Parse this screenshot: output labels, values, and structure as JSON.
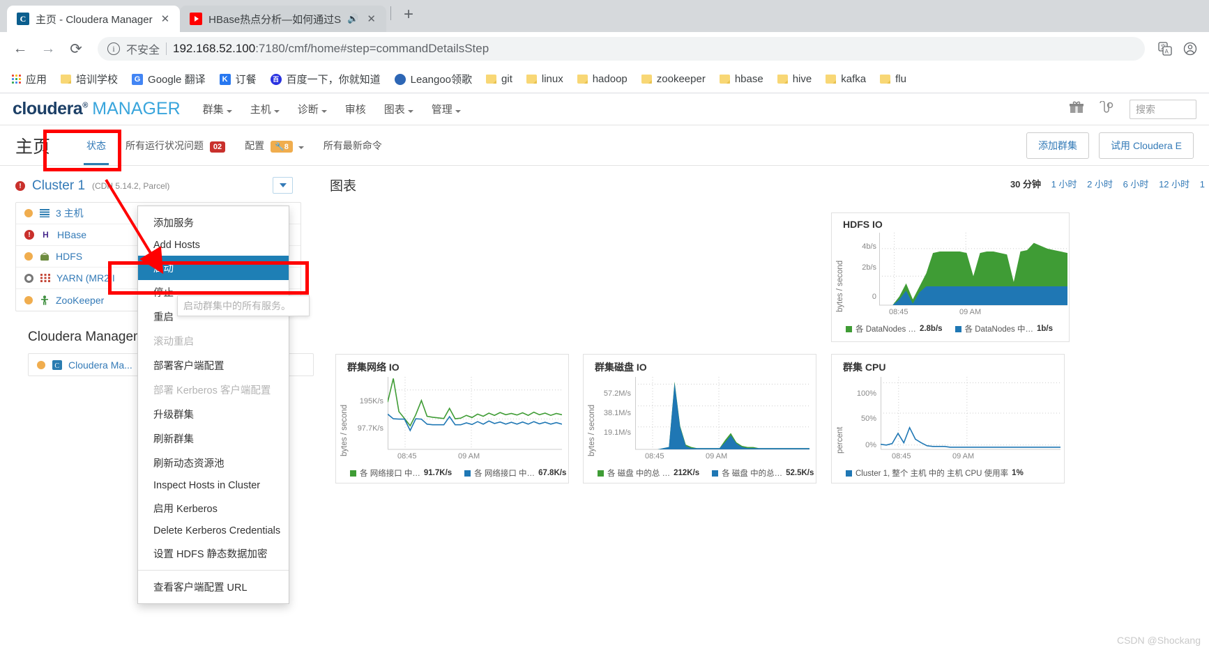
{
  "browser": {
    "tabs": [
      {
        "title": "主页 - Cloudera Manager",
        "favicon": "cloudera-icon",
        "active": true,
        "close": "✕"
      },
      {
        "title": "HBase热点分析—如何通过S",
        "favicon": "youtube-icon",
        "active": false,
        "speaker": "🔊",
        "close": "✕"
      }
    ],
    "new_tab_label": "+",
    "nav": {
      "back": "←",
      "forward": "→",
      "reload": "⟳"
    },
    "omnibox": {
      "info_icon": "ⓘ",
      "security_label": "不安全",
      "url_host": "192.168.52.100",
      "url_rest": ":7180/cmf/home#step=commandDetailsStep"
    },
    "toolbar_icons": [
      "translate-icon",
      "profile-icon"
    ],
    "bookmarks": [
      {
        "label": "应用",
        "icon": "apps-grid-icon"
      },
      {
        "label": "培训学校",
        "icon": "folder-icon"
      },
      {
        "label": "Google 翻译",
        "icon": "google-translate-icon"
      },
      {
        "label": "订餐",
        "icon": "k-icon"
      },
      {
        "label": "百度一下，你就知道",
        "icon": "baidu-icon"
      },
      {
        "label": "Leangoo领歌",
        "icon": "leangoo-icon"
      },
      {
        "label": "git",
        "icon": "folder-icon"
      },
      {
        "label": "linux",
        "icon": "folder-icon"
      },
      {
        "label": "hadoop",
        "icon": "folder-icon"
      },
      {
        "label": "zookeeper",
        "icon": "folder-icon"
      },
      {
        "label": "hbase",
        "icon": "folder-icon"
      },
      {
        "label": "hive",
        "icon": "folder-icon"
      },
      {
        "label": "kafka",
        "icon": "folder-icon"
      },
      {
        "label": "flu",
        "icon": "folder-icon"
      }
    ]
  },
  "cm_header": {
    "logo_primary": "cloudera",
    "logo_secondary": "MANAGER",
    "nav": [
      {
        "label": "群集",
        "has_caret": true
      },
      {
        "label": "主机",
        "has_caret": true
      },
      {
        "label": "诊断",
        "has_caret": true
      },
      {
        "label": "审核",
        "has_caret": false
      },
      {
        "label": "图表",
        "has_caret": true
      },
      {
        "label": "管理",
        "has_caret": true
      }
    ],
    "right_icons": [
      "gift-icon",
      "support-icon"
    ],
    "search_placeholder": "搜索"
  },
  "sub_header": {
    "page_title": "主页",
    "tabs": [
      {
        "label": "状态",
        "active": true
      },
      {
        "label": "所有运行状况问题",
        "active": false,
        "badge": "02",
        "badge_color": "#c9302c"
      },
      {
        "label": "配置",
        "active": false,
        "badge": "8",
        "badge_color": "#f0ad4e",
        "has_caret": true,
        "badge_icon": "wrench-icon"
      },
      {
        "label": "所有最新命令",
        "active": false
      }
    ],
    "buttons": [
      {
        "label": "添加群集"
      },
      {
        "label": "试用 Cloudera E"
      }
    ]
  },
  "sidebar": {
    "cluster": {
      "status_icon": "error-icon",
      "name": "Cluster 1",
      "version": "(CDH 5.14.2, Parcel)",
      "dropdown_icon": "chevron-down-icon"
    },
    "services": [
      {
        "status": "yellow",
        "icon": "hosts-icon",
        "label": "3 主机"
      },
      {
        "status": "error",
        "icon": "hbase-icon",
        "label": "HBase"
      },
      {
        "status": "yellow",
        "icon": "hdfs-icon",
        "label": "HDFS"
      },
      {
        "status": "ring",
        "icon": "yarn-icon",
        "label": "YARN (MR2 I"
      },
      {
        "status": "yellow",
        "icon": "zookeeper-icon",
        "label": "ZooKeeper"
      }
    ],
    "mgmt_section_title": "Cloudera Managem",
    "mgmt_services": [
      {
        "status": "yellow",
        "icon": "cm-icon",
        "label": "Cloudera Ma..."
      }
    ]
  },
  "menu": {
    "items": [
      {
        "label": "添加服务",
        "state": "normal"
      },
      {
        "label": "Add Hosts",
        "state": "normal"
      },
      {
        "label": "启动",
        "state": "selected"
      },
      {
        "label": "停止",
        "state": "normal"
      },
      {
        "label": "重启",
        "state": "normal"
      },
      {
        "label": "滚动重启",
        "state": "disabled"
      },
      {
        "label": "部署客户端配置",
        "state": "normal"
      },
      {
        "label": "部署 Kerberos 客户端配置",
        "state": "disabled"
      },
      {
        "label": "升级群集",
        "state": "normal"
      },
      {
        "label": "刷新群集",
        "state": "normal"
      },
      {
        "label": "刷新动态资源池",
        "state": "normal"
      },
      {
        "label": "Inspect Hosts in Cluster",
        "state": "normal"
      },
      {
        "label": "启用 Kerberos",
        "state": "normal"
      },
      {
        "label": "Delete Kerberos Credentials",
        "state": "normal"
      },
      {
        "label": "设置 HDFS 静态数据加密",
        "state": "normal"
      },
      {
        "label": "查看客户端配置 URL",
        "state": "normal",
        "separator_before": true
      }
    ],
    "tooltip": "启动群集中的所有服务。"
  },
  "charts_panel": {
    "title": "图表",
    "time_ranges": [
      {
        "label": "30 分钟",
        "selected": true
      },
      {
        "label": "1 小时",
        "selected": false
      },
      {
        "label": "2 小时",
        "selected": false
      },
      {
        "label": "6 小时",
        "selected": false
      },
      {
        "label": "12 小时",
        "selected": false
      },
      {
        "label": "1",
        "selected": false
      }
    ]
  },
  "chart_data": [
    {
      "type": "area",
      "id": "hdfs-io",
      "title": "HDFS IO",
      "ylabel": "bytes / second",
      "yticks": [
        "0",
        "2b/s",
        "4b/s"
      ],
      "ylim": [
        0,
        5
      ],
      "xticks": [
        "08:45",
        "09 AM"
      ],
      "series": [
        {
          "name": "各 DataNodes …",
          "value": "2.8b/s",
          "color": "#3f9c35",
          "values": [
            0,
            0,
            0,
            0.6,
            1.5,
            0.4,
            1.3,
            2.2,
            3.6,
            3.7,
            3.7,
            3.7,
            3.7,
            3.6,
            2.0,
            3.6,
            3.7,
            3.7,
            3.6,
            3.5,
            1.6,
            3.7,
            3.8,
            4.3,
            4.1,
            3.9,
            3.8,
            3.7,
            3.6
          ]
        },
        {
          "name": "各 DataNodes 中…",
          "value": "1b/s",
          "color": "#1f77b4",
          "values": [
            0,
            0,
            0,
            0.4,
            1.0,
            0.1,
            0.9,
            1.3,
            1.3,
            1.3,
            1.3,
            1.3,
            1.3,
            1.3,
            1.3,
            1.3,
            1.3,
            1.3,
            1.3,
            1.3,
            1.3,
            1.3,
            1.3,
            1.3,
            1.3,
            1.3,
            1.3,
            1.3,
            1.3
          ]
        }
      ]
    },
    {
      "type": "line",
      "id": "cluster-network-io",
      "title": "群集网络 IO",
      "ylabel": "bytes / second",
      "yticks": [
        "97.7K/s",
        "195K/s"
      ],
      "ylim": [
        0,
        230
      ],
      "xticks": [
        "08:45",
        "09 AM"
      ],
      "series": [
        {
          "name": "各 网络接口 中…",
          "value": "91.7K/s",
          "color": "#3f9c35",
          "values": [
            150,
            225,
            120,
            98,
            75,
            110,
            155,
            105,
            102,
            100,
            98,
            130,
            97,
            99,
            108,
            101,
            112,
            105,
            115,
            108,
            117,
            110,
            114,
            109,
            116,
            108,
            118,
            110,
            115,
            108,
            114,
            110
          ]
        },
        {
          "name": "各 网络接口 中…",
          "value": "67.8K/s",
          "color": "#1f77b4",
          "values": [
            112,
            97,
            96,
            96,
            60,
            97,
            96,
            80,
            78,
            78,
            78,
            104,
            78,
            78,
            84,
            79,
            88,
            80,
            90,
            82,
            87,
            80,
            86,
            80,
            87,
            80,
            88,
            81,
            86,
            80,
            85,
            80
          ]
        }
      ]
    },
    {
      "type": "area",
      "id": "cluster-disk-io",
      "title": "群集磁盘 IO",
      "ylabel": "bytes / second",
      "yticks": [
        "19.1M/s",
        "38.1M/s",
        "57.2M/s"
      ],
      "ylim": [
        0,
        62
      ],
      "xticks": [
        "08:45",
        "09 AM"
      ],
      "series": [
        {
          "name": "各 磁盘 中的总 …",
          "value": "212K/s",
          "color": "#3f9c35",
          "values": [
            0,
            0,
            0,
            0,
            0,
            1,
            2,
            58,
            20,
            4,
            2,
            1,
            1,
            1,
            1,
            1,
            8,
            14,
            6,
            3,
            2,
            2,
            1,
            1,
            1,
            1,
            1,
            1,
            1,
            1,
            1,
            1
          ]
        },
        {
          "name": "各 磁盘 中的总…",
          "value": "52.5K/s",
          "color": "#1f77b4",
          "values": [
            0,
            0,
            0,
            0,
            0,
            1,
            2,
            57,
            19,
            3,
            1,
            1,
            1,
            1,
            1,
            1,
            6,
            12,
            5,
            2,
            1,
            1,
            1,
            1,
            1,
            1,
            1,
            1,
            1,
            1,
            1,
            1
          ]
        }
      ]
    },
    {
      "type": "line",
      "id": "cluster-cpu",
      "title": "群集 CPU",
      "ylabel": "percent",
      "yticks": [
        "0%",
        "50%",
        "100%"
      ],
      "ylim": [
        0,
        100
      ],
      "xticks": [
        "08:45",
        "09 AM"
      ],
      "series": [
        {
          "name": "Cluster 1, 整个 主机 中的 主机 CPU 使用率",
          "value": "1%",
          "color": "#1f77b4",
          "values": [
            7,
            6,
            8,
            22,
            9,
            30,
            14,
            9,
            5,
            4,
            4,
            4,
            3,
            3,
            3,
            3,
            3,
            3,
            3,
            3,
            3,
            3,
            3,
            3,
            3,
            3,
            3,
            3,
            3,
            3,
            3,
            3
          ]
        }
      ]
    }
  ],
  "watermark": "CSDN @Shockang"
}
